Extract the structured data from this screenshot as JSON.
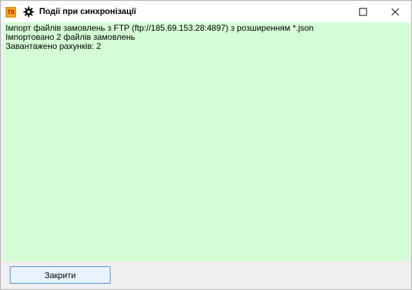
{
  "window": {
    "app_icon_text": "TS",
    "title": "Події при синхронізації",
    "icons": {
      "app": "ts-app-icon",
      "settings": "gear-icon",
      "maximize": "maximize-icon",
      "close": "close-icon"
    }
  },
  "log": {
    "lines": [
      "Імпорт файлів замовлень з FTP (ftp://185.69.153.28:4897) з розширенням *.json",
      "Імпортовано 2 файлів замовлень",
      "Завантажено рахунків: 2"
    ],
    "background": "#d5fdd5"
  },
  "footer": {
    "close_label": "Закрити"
  }
}
